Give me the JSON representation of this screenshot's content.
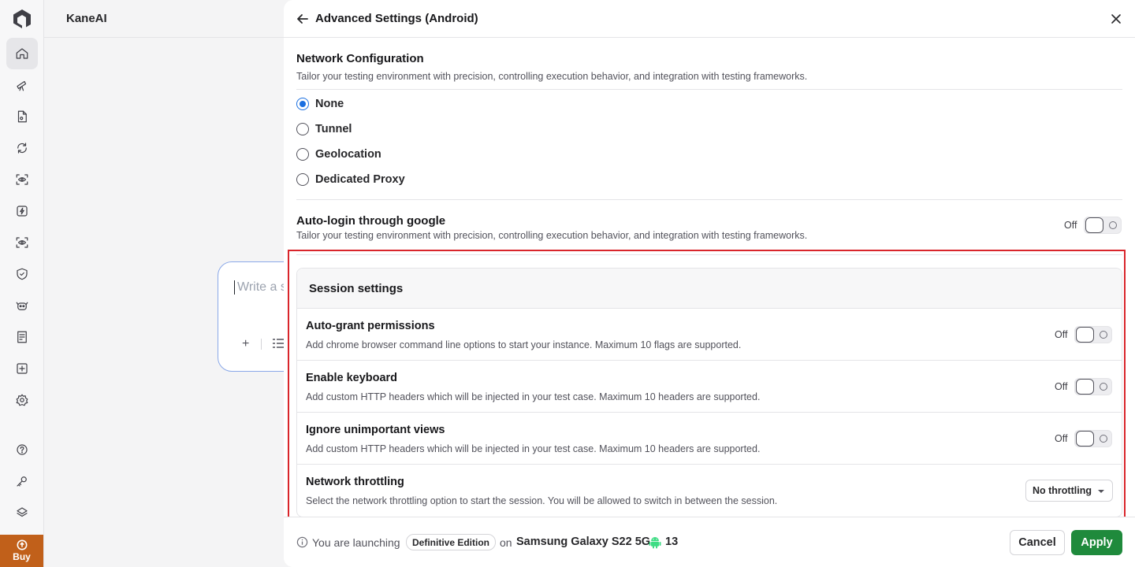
{
  "app": {
    "title": "KaneAI"
  },
  "sidebar": {
    "items": [
      {
        "icon": "home-icon",
        "active": true
      },
      {
        "icon": "telescope-icon"
      },
      {
        "icon": "document-icon"
      },
      {
        "icon": "refresh-icon"
      },
      {
        "icon": "eye-scan-icon"
      },
      {
        "icon": "bolt-icon"
      },
      {
        "icon": "eye-scan-icon-2"
      },
      {
        "icon": "shield-icon"
      },
      {
        "icon": "bot-icon"
      },
      {
        "icon": "report-icon"
      },
      {
        "icon": "plus-box-icon"
      },
      {
        "icon": "gear-icon"
      },
      {
        "icon": "help-icon"
      },
      {
        "icon": "key-icon"
      },
      {
        "icon": "layers-icon"
      }
    ],
    "buy_label": "Buy"
  },
  "prompt": {
    "placeholder": "Write a s"
  },
  "drawer": {
    "title": "Advanced Settings (Android)",
    "network": {
      "title": "Network Configuration",
      "description": "Tailor your testing environment with precision, controlling execution behavior, and integration with testing frameworks.",
      "options": [
        "None",
        "Tunnel",
        "Geolocation",
        "Dedicated Proxy"
      ],
      "selected": "None"
    },
    "autologin": {
      "title": "Auto-login through google",
      "description": "Tailor your testing environment with precision, controlling execution behavior, and integration with testing frameworks.",
      "state": "Off"
    },
    "session": {
      "title": "Session settings",
      "rows": [
        {
          "title": "Auto-grant permissions",
          "description": "Add chrome browser command line options to start your instance. Maximum 10 flags are supported.",
          "state": "Off"
        },
        {
          "title": "Enable keyboard",
          "description": "Add custom HTTP headers which will be injected in your test case. Maximum 10 headers are supported.",
          "state": "Off"
        },
        {
          "title": "Ignore unimportant views",
          "description": "Add custom HTTP headers which will be injected in your test case. Maximum 10 headers are supported.",
          "state": "Off"
        },
        {
          "title": "Network throttling",
          "description": "Select the network throttling option to start the session. You will be allowed to switch in between the session.",
          "select_value": "No throttling"
        }
      ]
    },
    "footer": {
      "launch_text": "You are launching",
      "edition": "Definitive Edition",
      "on_text": "on",
      "device": "Samsung Galaxy S22 5G",
      "os_version": "13",
      "cancel_label": "Cancel",
      "apply_label": "Apply"
    }
  },
  "colors": {
    "accent_blue": "#1a6fe0",
    "apply_green": "#1f8a3c",
    "highlight_red": "#d9252b",
    "buy_orange": "#c1601a",
    "android_green": "#3ddc84"
  }
}
